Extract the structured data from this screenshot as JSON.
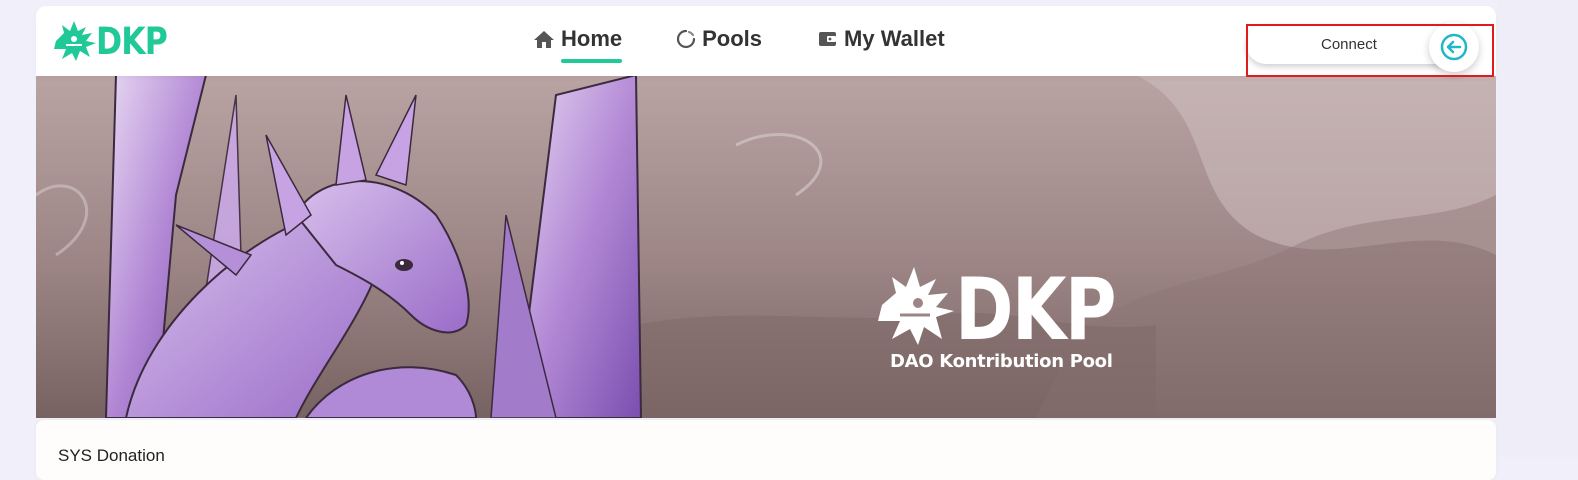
{
  "brand": {
    "name": "DKP",
    "color": "#20c997"
  },
  "nav": {
    "items": [
      {
        "label": "Home",
        "icon": "home-icon",
        "active": true
      },
      {
        "label": "Pools",
        "icon": "loading-circle-icon",
        "active": false
      },
      {
        "label": "My Wallet",
        "icon": "wallet-icon",
        "active": false
      }
    ]
  },
  "connect": {
    "label": "Connect",
    "icon": "sign-in-arrow-icon",
    "accent": "#1fb8c9",
    "highlight_color": "#e01b1b"
  },
  "banner": {
    "title": "DKP",
    "subtitle": "DAO Kontribution Pool"
  },
  "section": {
    "title": "SYS Donation"
  }
}
